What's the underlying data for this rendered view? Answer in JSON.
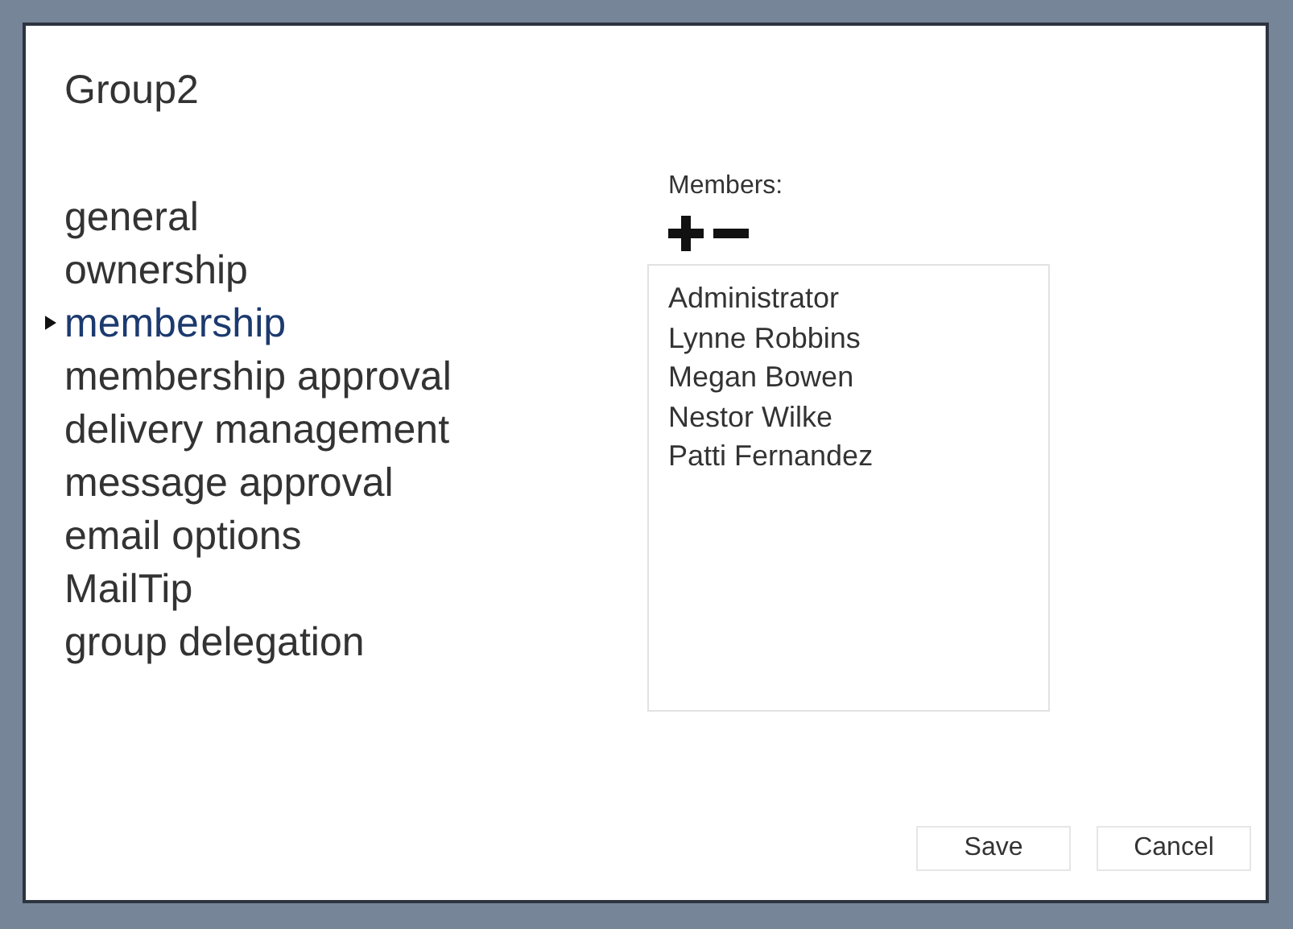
{
  "dialog": {
    "title": "Group2"
  },
  "navigation": [
    {
      "label": "general",
      "selected": false
    },
    {
      "label": "ownership",
      "selected": false
    },
    {
      "label": "membership",
      "selected": true
    },
    {
      "label": "membership approval",
      "selected": false
    },
    {
      "label": "delivery management",
      "selected": false
    },
    {
      "label": "message approval",
      "selected": false
    },
    {
      "label": "email options",
      "selected": false
    },
    {
      "label": "MailTip",
      "selected": false
    },
    {
      "label": "group delegation",
      "selected": false
    }
  ],
  "members": {
    "label": "Members:",
    "items": [
      "Administrator",
      "Lynne Robbins",
      "Megan Bowen",
      "Nestor Wilke",
      "Patti Fernandez"
    ]
  },
  "buttons": [
    "Save",
    "Cancel"
  ]
}
